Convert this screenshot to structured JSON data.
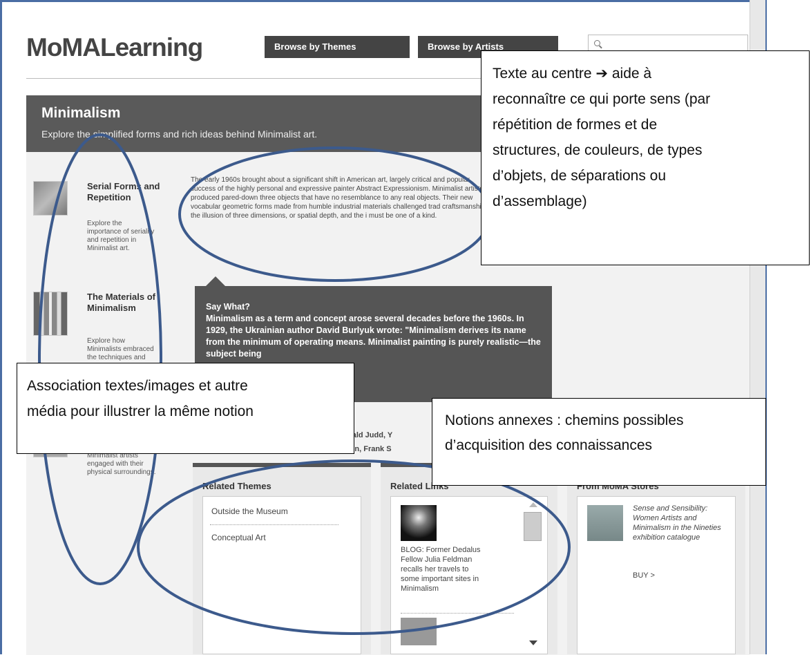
{
  "header": {
    "logo": "MoMALearning",
    "nav": [
      "Browse by Themes",
      "Browse by Artists"
    ]
  },
  "banner": {
    "title": "Minimalism",
    "subtitle": "Explore the simplified forms and rich ideas behind Minimalist art."
  },
  "sidebar": {
    "items": [
      {
        "title": "Serial Forms and Repetition",
        "desc": "Explore the importance of seriality and repetition in Minimalist art."
      },
      {
        "title": "The Materials of Minimalism",
        "desc": "Explore how Minimalists embraced the techniques and"
      },
      {
        "title": "",
        "desc": "Minimalist artists engaged with their physical surroundings."
      }
    ]
  },
  "intro": "The early 1960s brought about a significant shift in American art, largely critical and popular success of the highly personal and expressive painter Abstract Expressionism. Minimalist artists produced pared-down three objects that have no resemblance to any real objects. Their new vocabular geometric forms made from humble industrial materials challenged trad craftsmanship, the illusion of three dimensions, or spatial depth, and the i must be one of a kind.",
  "saywhat": {
    "heading": "Say What?",
    "text": "Minimalism as a term and concept arose several decades before the 1960s. In 1929, the Ukrainian author David Burlyuk wrote: \"Minimalism derives its name from the minimum of operating means. Minimalist painting is purely realistic—the subject being"
  },
  "artists": {
    "line1": "se, Donald Judd, Y",
    "line2": "Smithson, Frank S"
  },
  "panels": {
    "related_themes": {
      "heading": "Related Themes",
      "items": [
        "Outside the Museum",
        "Conceptual Art"
      ]
    },
    "related_links": {
      "heading": "Related Links",
      "item": "BLOG: Former Dedalus Fellow Julia Feldman recalls her travels to some important sites in Minimalism"
    },
    "stores": {
      "heading": "From MoMA Stores",
      "item": "Sense and Sensibility: Women Artists and Minimalism in the Nineties exhibition catalogue",
      "buy": "BUY >"
    }
  },
  "callouts": {
    "center": [
      "Texte au centre ➔ aide à",
      "reconnaître ce qui porte sens (par",
      "répétition de formes et de",
      "structures, de couleurs, de types",
      "d’objets, de séparations ou",
      "d’assemblage)"
    ],
    "left": [
      "Association textes/images et autre",
      "média pour illustrer la même notion"
    ],
    "right": [
      "Notions annexes : chemins possibles",
      "d’acquisition des connaissances"
    ]
  },
  "colors": {
    "oval": "#3c5a8c",
    "dark": "#555555"
  }
}
